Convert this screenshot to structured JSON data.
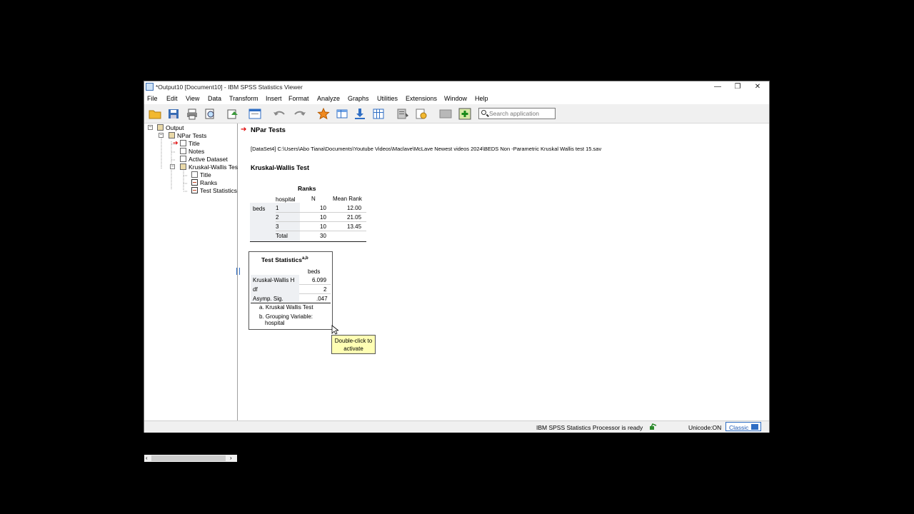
{
  "window": {
    "title": "*Output10 [Document10] - IBM SPSS Statistics Viewer",
    "controls": {
      "minimize": "—",
      "restore": "❐",
      "close": "✕"
    }
  },
  "menu": [
    "File",
    "Edit",
    "View",
    "Data",
    "Transform",
    "Insert",
    "Format",
    "Analyze",
    "Graphs",
    "Utilities",
    "Extensions",
    "Window",
    "Help"
  ],
  "toolbar": {
    "icons": [
      "open-icon",
      "save-icon",
      "print-icon",
      "print-preview-icon",
      "export-icon",
      "recall-dialog-icon",
      "undo-icon",
      "redo-icon",
      "go-to-case-icon",
      "go-to-variable-icon",
      "insert-output-icon",
      "split-icon",
      "designate-window-icon",
      "create-title-icon",
      "show-all-icon",
      "hide-icon",
      "insert-new-icon"
    ],
    "search_placeholder": "Search application"
  },
  "nav": {
    "items": [
      {
        "label": "Output",
        "level": 0
      },
      {
        "label": "NPar Tests",
        "level": 1
      },
      {
        "label": "Title",
        "level": 2
      },
      {
        "label": "Notes",
        "level": 2
      },
      {
        "label": "Active Dataset",
        "level": 2
      },
      {
        "label": "Kruskal-Wallis Tes",
        "level": 2
      },
      {
        "label": "Title",
        "level": 3
      },
      {
        "label": "Ranks",
        "level": 3
      },
      {
        "label": "Test Statistics",
        "level": 3
      }
    ]
  },
  "content": {
    "heading": "NPar Tests",
    "dataset_path": "[DataSet4] C:\\Users\\Abo Tiana\\Documents\\Youtube Videos\\Maclave\\McLave Newest videos 2024\\BEDS Non -Parametric Kruskal Wallis test 15.sav",
    "test_title": "Kruskal-Wallis Test",
    "ranks": {
      "title": "Ranks",
      "headers": [
        "hospital",
        "N",
        "Mean Rank"
      ],
      "variable": "beds",
      "rows": [
        {
          "group": "1",
          "n": "10",
          "mean_rank": "12.00"
        },
        {
          "group": "2",
          "n": "10",
          "mean_rank": "21.05"
        },
        {
          "group": "3",
          "n": "10",
          "mean_rank": "13.45"
        },
        {
          "group": "Total",
          "n": "30",
          "mean_rank": ""
        }
      ]
    },
    "test_stats": {
      "title": "Test Statistics",
      "superscript": "a,b",
      "column": "beds",
      "rows": [
        {
          "label": "Kruskal-Wallis H",
          "value": "6.099"
        },
        {
          "label": "df",
          "value": "2"
        },
        {
          "label": "Asymp. Sig.",
          "value": ".047"
        }
      ],
      "footnote_a": "a. Kruskal Wallis Test",
      "footnote_b1": "b. Grouping Variable:",
      "footnote_b2": "hospital"
    },
    "tooltip_line1": "Double-click to",
    "tooltip_line2": "activate"
  },
  "status": {
    "processor": "IBM SPSS Statistics Processor is ready",
    "unicode": "Unicode:ON",
    "mode": "Classic"
  }
}
